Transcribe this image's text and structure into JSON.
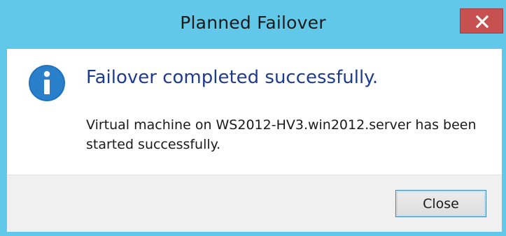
{
  "dialog": {
    "title": "Planned Failover",
    "close_icon": "close-icon",
    "info_icon": "info-icon",
    "main_instruction": "Failover completed successfully.",
    "body_text": "Virtual machine on WS2012-HV3.win2012.server has been started successfully.",
    "close_button_label": "Close"
  },
  "colors": {
    "titlebar": "#62c8ea",
    "close_x_bg": "#c75050",
    "main_instruction": "#1e3c8e",
    "info_icon": "#1e73be",
    "footer_bg": "#f0f0f0",
    "button_border": "#3c7fb1"
  }
}
